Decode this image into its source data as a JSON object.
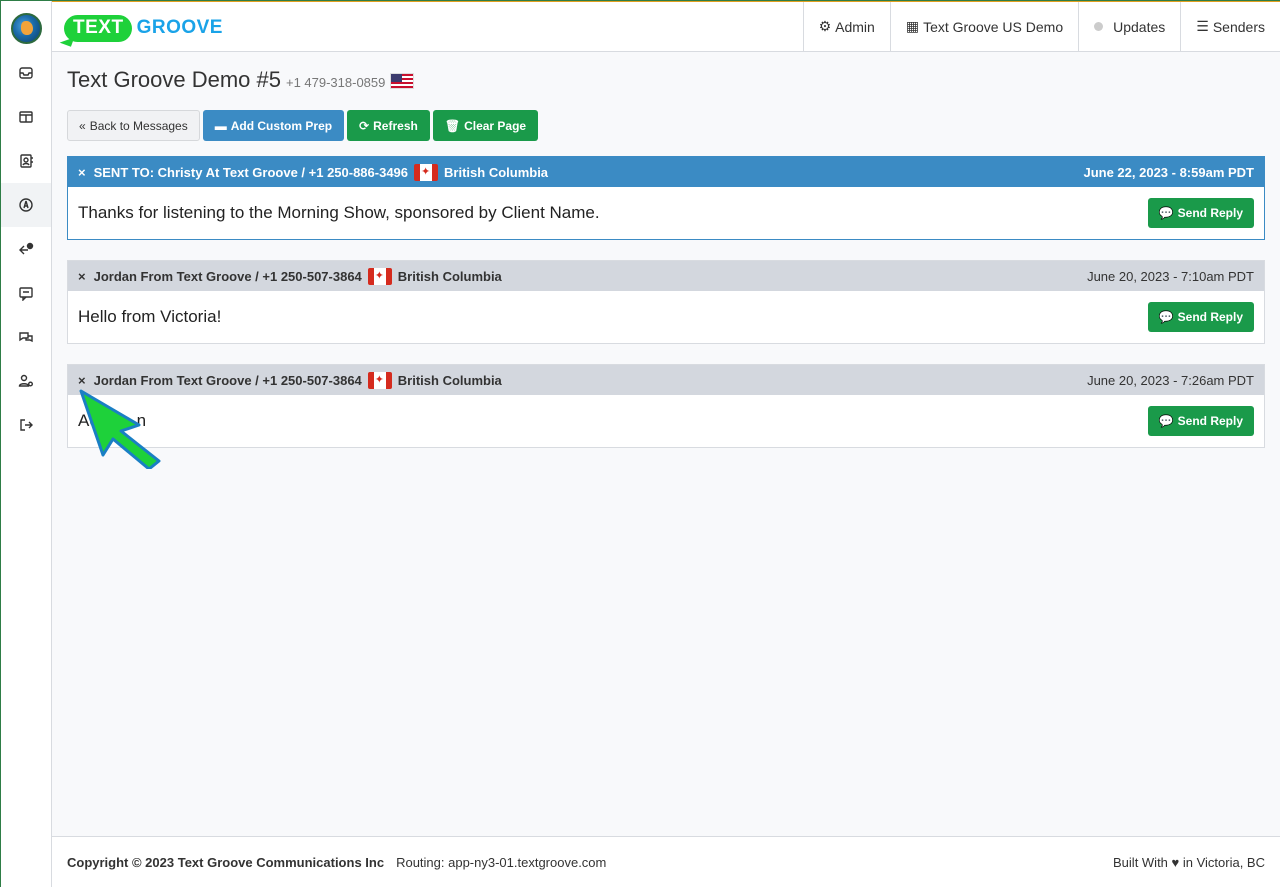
{
  "logo": {
    "part1": "TEXT",
    "part2": "GROOVE"
  },
  "nav": {
    "admin": "Admin",
    "account": "Text Groove US Demo",
    "updates": "Updates",
    "senders": "Senders"
  },
  "sidebar": {
    "items": [
      {
        "icon": "inbox-icon"
      },
      {
        "icon": "layout-icon"
      },
      {
        "icon": "contacts-icon"
      },
      {
        "icon": "compass-icon"
      },
      {
        "icon": "reply-icon"
      },
      {
        "icon": "chat-icon"
      },
      {
        "icon": "conversations-icon"
      },
      {
        "icon": "user-settings-icon"
      },
      {
        "icon": "logout-icon"
      }
    ]
  },
  "page": {
    "title": "Text Groove Demo #5",
    "phone": "+1 479-318-0859"
  },
  "buttons": {
    "back": "Back to Messages",
    "custom_prep": "Add Custom Prep",
    "refresh": "Refresh",
    "clear": "Clear Page"
  },
  "messages": [
    {
      "prefix": "SENT TO:",
      "sender": "Christy At Text Groove / +1 250-886-3496",
      "region": "British Columbia",
      "date": "June 22, 2023 - 8:59am PDT",
      "body": "Thanks for listening to the Morning Show, sponsored by Client Name.",
      "reply": "Send Reply"
    },
    {
      "sender": "Jordan From Text Groove / +1 250-507-3864",
      "region": "British Columbia",
      "date": "June 20, 2023 - 7:10am PDT",
      "body": "Hello from Victoria!",
      "reply": "Send Reply"
    },
    {
      "sender": "Jordan From Text Groove / +1 250-507-3864",
      "region": "British Columbia",
      "date": "June 20, 2023 - 7:26am PDT",
      "body": "Ae        n",
      "reply": "Send Reply"
    }
  ],
  "footer": {
    "copyright": "Copyright © 2023 Text Groove Communications Inc",
    "routing": "Routing: app-ny3-01.textgroove.com",
    "built": "Built With ♥ in Victoria, BC"
  },
  "colors": {
    "accent_blue": "#3b8bc4",
    "accent_green": "#1a9a4a",
    "logo_green": "#1ed13a",
    "logo_blue": "#1aa3e8"
  }
}
